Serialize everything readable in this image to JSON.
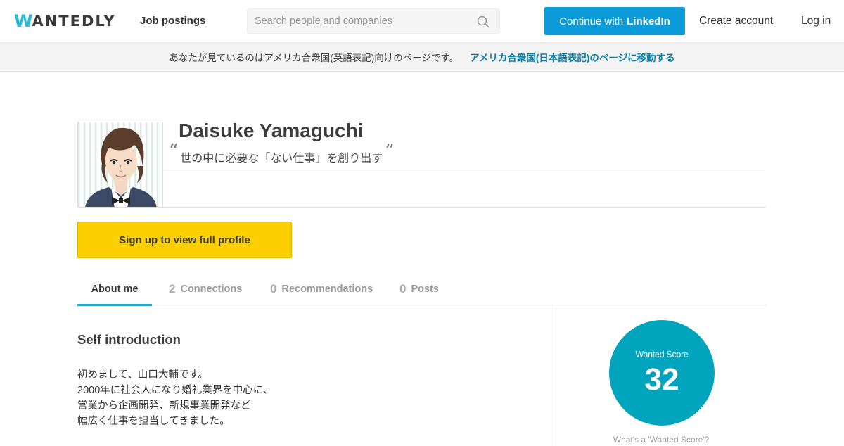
{
  "header": {
    "logo_first": "W",
    "logo_rest": "ANTEDLY",
    "nav_jobs": "Job postings",
    "search_placeholder": "Search people and companies",
    "linkedin_prefix": "Continue with",
    "linkedin_brand": "LinkedIn",
    "create_account": "Create account",
    "log_in": "Log in",
    "colors": {
      "brand_cyan": "#21bddb",
      "linkedin_blue": "#0a9bd8"
    }
  },
  "banner": {
    "message": "あなたが見ているのはアメリカ合衆国(英語表記)向けのページです。",
    "link": "アメリカ合衆国(日本語表記)のページに移動する"
  },
  "profile": {
    "name": "Daisuke Yamaguchi",
    "quote_open": "“",
    "tagline": "世の中に必要な「ない仕事」を創り出す",
    "quote_close": "”",
    "signup_label": "Sign up to view full profile",
    "signup_color": "#fccf00"
  },
  "tabs": {
    "about": {
      "label": "About me"
    },
    "connections": {
      "count": "2",
      "label": "Connections"
    },
    "recommendations": {
      "count": "0",
      "label": "Recommendations"
    },
    "posts": {
      "count": "0",
      "label": "Posts"
    },
    "active_color": "#21a7c9"
  },
  "about": {
    "title": "Self introduction",
    "lines": [
      "初めまして、山口大輔です。",
      "2000年に社会人になり婚礼業界を中心に、",
      "営業から企画開発、新規事業開発など",
      "幅広く仕事を担当してきました。"
    ]
  },
  "score": {
    "label": "Wanted Score",
    "value": "32",
    "help": "What's a 'Wanted Score'?",
    "color": "#00a4bd"
  }
}
